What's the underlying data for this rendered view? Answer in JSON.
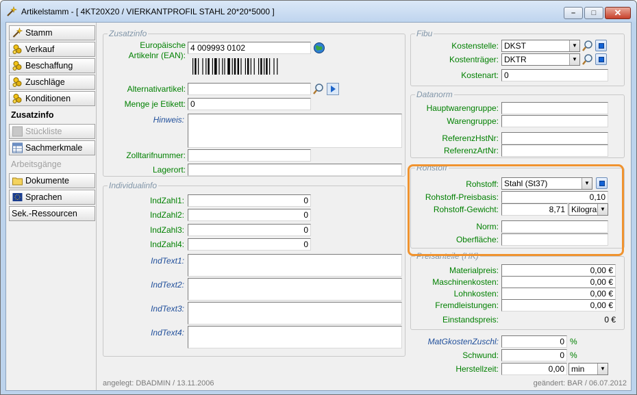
{
  "window": {
    "title": "Artikelstamm - [ 4KT20X20 / VIERKANTPROFIL STAHL 20*20*5000 ]",
    "minimize": "–",
    "maximize": "□",
    "close": "✕"
  },
  "nav": {
    "items": [
      {
        "label": "Stamm",
        "icon": "wand-icon"
      },
      {
        "label": "Verkauf",
        "icon": "coins-icon"
      },
      {
        "label": "Beschaffung",
        "icon": "coins-icon"
      },
      {
        "label": "Zuschläge",
        "icon": "coins-icon"
      },
      {
        "label": "Konditionen",
        "icon": "coins-icon"
      },
      {
        "label": "Zusatzinfo"
      },
      {
        "label": "Stückliste",
        "icon": "grid-icon"
      },
      {
        "label": "Sachmerkmale",
        "icon": "grid-icon"
      },
      {
        "label": "Arbeitsgänge"
      },
      {
        "label": "Dokumente",
        "icon": "folder-icon"
      },
      {
        "label": "Sprachen",
        "icon": "flag-icon"
      },
      {
        "label": "Sek.-Ressourcen"
      }
    ]
  },
  "zusatzinfo": {
    "legend": "Zusatzinfo",
    "ean_label": "Europäische\nArtikelnr (EAN):",
    "ean_value": "4 009993 0102",
    "alternativ_label": "Alternativartikel:",
    "alternativ_value": "",
    "menge_label": "Menge je Etikett:",
    "menge_value": "0",
    "hinweis_label": "Hinweis:",
    "hinweis_value": "",
    "zolltarif_label": "Zolltarifnummer:",
    "zolltarif_value": "",
    "lagerort_label": "Lagerort:",
    "lagerort_value": ""
  },
  "individualinfo": {
    "legend": "Individualinfo",
    "zahlen": [
      {
        "label": "IndZahl1:",
        "value": "0"
      },
      {
        "label": "IndZahl2:",
        "value": "0"
      },
      {
        "label": "IndZahl3:",
        "value": "0"
      },
      {
        "label": "IndZahl4:",
        "value": "0"
      }
    ],
    "texte": [
      {
        "label": "IndText1:",
        "value": ""
      },
      {
        "label": "IndText2:",
        "value": ""
      },
      {
        "label": "IndText3:",
        "value": ""
      },
      {
        "label": "IndText4:",
        "value": ""
      }
    ]
  },
  "fibu": {
    "legend": "Fibu",
    "kostenstelle_label": "Kostenstelle:",
    "kostenstelle_value": "DKST",
    "kostentraeger_label": "Kostenträger:",
    "kostentraeger_value": "DKTR",
    "kostenart_label": "Kostenart:",
    "kostenart_value": "0"
  },
  "datanorm": {
    "legend": "Datanorm",
    "hauptwarengruppe_label": "Hauptwarengruppe:",
    "warengruppe_label": "Warengruppe:",
    "referenzhst_label": "ReferenzHstNr:",
    "referenzart_label": "ReferenzArtNr:"
  },
  "rohstoff": {
    "legend": "Rohstoff",
    "rohstoff_label": "Rohstoff:",
    "rohstoff_value": "Stahl (St37)",
    "preisbasis_label": "Rohstoff-Preisbasis:",
    "preisbasis_value": "0,10",
    "gewicht_label": "Rohstoff-Gewicht:",
    "gewicht_value": "8,71",
    "gewicht_unit": "Kilogra",
    "norm_label": "Norm:",
    "norm_value": "",
    "oberflaeche_label": "Oberfläche:",
    "oberflaeche_value": ""
  },
  "preisanteile": {
    "legend": "Preisanteile (HK)",
    "rows": [
      {
        "label": "Materialpreis:",
        "value": "0,00 €"
      },
      {
        "label": "Maschinenkosten:",
        "value": "0,00 €"
      },
      {
        "label": "Lohnkosten:",
        "value": "0,00 €"
      },
      {
        "label": "Fremdleistungen:",
        "value": "0,00 €"
      }
    ],
    "einstand_label": "Einstandspreis:",
    "einstand_value": "0 €"
  },
  "extra": {
    "matgk_label": "MatGkostenZuschl:",
    "matgk_value": "0",
    "matgk_unit": "%",
    "schwund_label": "Schwund:",
    "schwund_value": "0",
    "schwund_unit": "%",
    "herstellzeit_label": "Herstellzeit:",
    "herstellzeit_value": "0,00",
    "herstellzeit_unit": "min"
  },
  "footer": {
    "created": "angelegt: DBADMIN / 13.11.2006",
    "changed": "geändert: BAR / 06.07.2012"
  },
  "colors": {
    "label_green": "#008000",
    "label_blue": "#1f4e9a",
    "highlight": "#f0932f"
  }
}
